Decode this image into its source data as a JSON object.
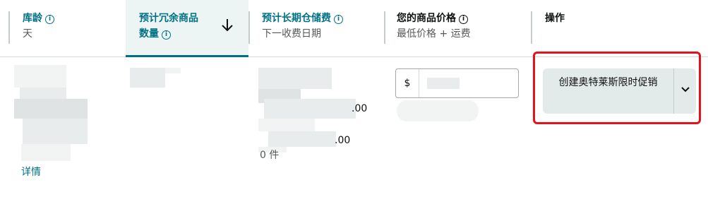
{
  "columns": {
    "age": {
      "title": "库龄",
      "subtitle": "天"
    },
    "excess": {
      "title_line1": "预计冗余商品",
      "title_line2": "数量"
    },
    "storage": {
      "title": "预计长期仓储费",
      "subtitle": "下一收费日期"
    },
    "price": {
      "title": "您的商品价格",
      "subtitle": "最低价格 + 运费"
    },
    "action": {
      "title": "操作"
    }
  },
  "row": {
    "age_details_link": "详情",
    "storage_partial_value_1": ".00",
    "storage_partial_value_2": ".00",
    "storage_units": "0 件",
    "currency_symbol": "$",
    "action_button_label": "创建奥特莱斯限时促销"
  },
  "colors": {
    "teal": "#007185",
    "highlight": "#e3121b",
    "sorted_bg": "#edf4f4"
  }
}
